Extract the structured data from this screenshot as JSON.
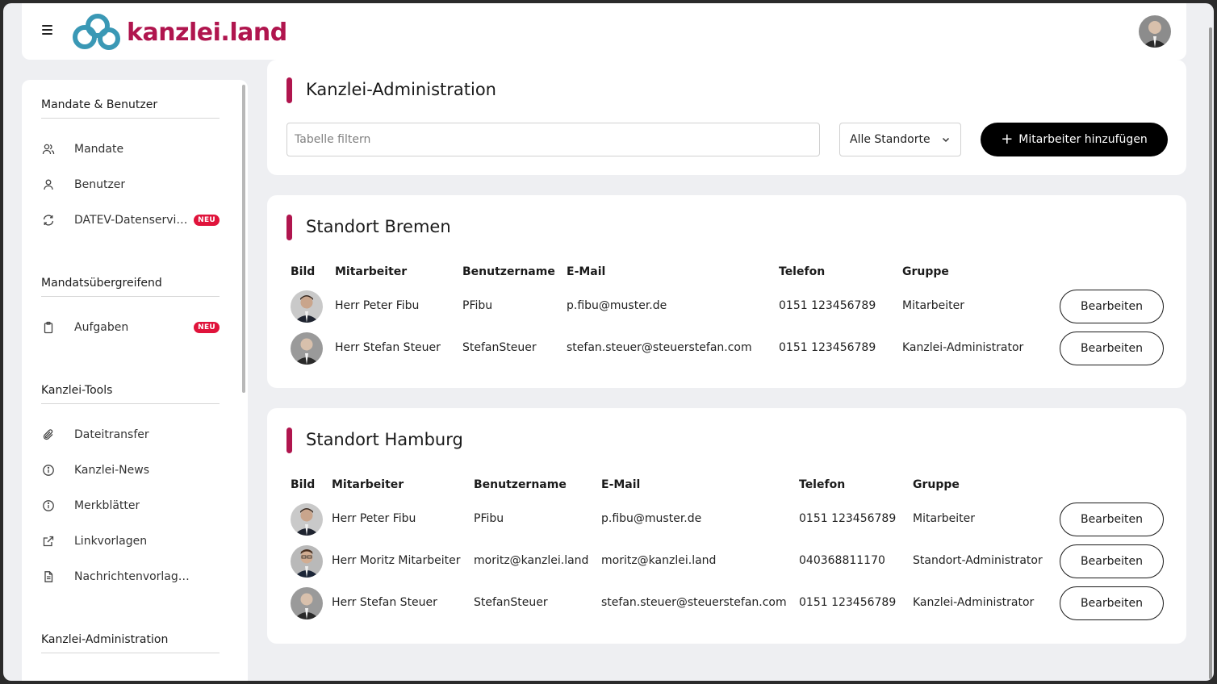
{
  "brand": {
    "name": "kanzlei.land",
    "accent": "#b0154e"
  },
  "sidebar": {
    "sections": [
      {
        "title": "Mandate & Benutzer",
        "items": [
          {
            "label": "Mandate",
            "icon": "users-icon"
          },
          {
            "label": "Benutzer",
            "icon": "user-icon"
          },
          {
            "label": "DATEV-Datenservice",
            "icon": "sync-icon",
            "badge": "NEU"
          }
        ]
      },
      {
        "title": "Mandatsübergreifend",
        "items": [
          {
            "label": "Aufgaben",
            "icon": "clipboard-icon",
            "badge": "NEU"
          }
        ]
      },
      {
        "title": "Kanzlei-Tools",
        "items": [
          {
            "label": "Dateitransfer",
            "icon": "paperclip-icon"
          },
          {
            "label": "Kanzlei-News",
            "icon": "info-icon"
          },
          {
            "label": "Merkblätter",
            "icon": "info-icon"
          },
          {
            "label": "Linkvorlagen",
            "icon": "external-link-icon"
          },
          {
            "label": "Nachrichtenvorlagen",
            "icon": "document-icon"
          }
        ]
      },
      {
        "title": "Kanzlei-Administration",
        "items": []
      }
    ]
  },
  "admin": {
    "title": "Kanzlei-Administration",
    "filter_placeholder": "Tabelle filtern",
    "location_select": "Alle Standorte",
    "add_button": "Mitarbeiter hinzufügen"
  },
  "columns": {
    "bild": "Bild",
    "mitarbeiter": "Mitarbeiter",
    "benutzername": "Benutzername",
    "email": "E-Mail",
    "telefon": "Telefon",
    "gruppe": "Gruppe"
  },
  "edit_label": "Bearbeiten",
  "locations": [
    {
      "title": "Standort Bremen",
      "rows": [
        {
          "name": "Herr Peter Fibu",
          "username": "PFibu",
          "email": "p.fibu@muster.de",
          "phone": "0151 123456789",
          "group": "Mitarbeiter"
        },
        {
          "name": "Herr Stefan Steuer",
          "username": "StefanSteuer",
          "email": "stefan.steuer@steuerstefan.com",
          "phone": "0151 123456789",
          "group": "Kanzlei-Administrator"
        }
      ]
    },
    {
      "title": "Standort Hamburg",
      "rows": [
        {
          "name": "Herr Peter Fibu",
          "username": "PFibu",
          "email": "p.fibu@muster.de",
          "phone": "0151 123456789",
          "group": "Mitarbeiter"
        },
        {
          "name": "Herr Moritz Mitarbeiter",
          "username": "moritz@kanzlei.land",
          "email": "moritz@kanzlei.land",
          "phone": "040368811170",
          "group": "Standort-Administrator"
        },
        {
          "name": "Herr Stefan Steuer",
          "username": "StefanSteuer",
          "email": "stefan.steuer@steuerstefan.com",
          "phone": "0151 123456789",
          "group": "Kanzlei-Administrator"
        }
      ]
    }
  ]
}
